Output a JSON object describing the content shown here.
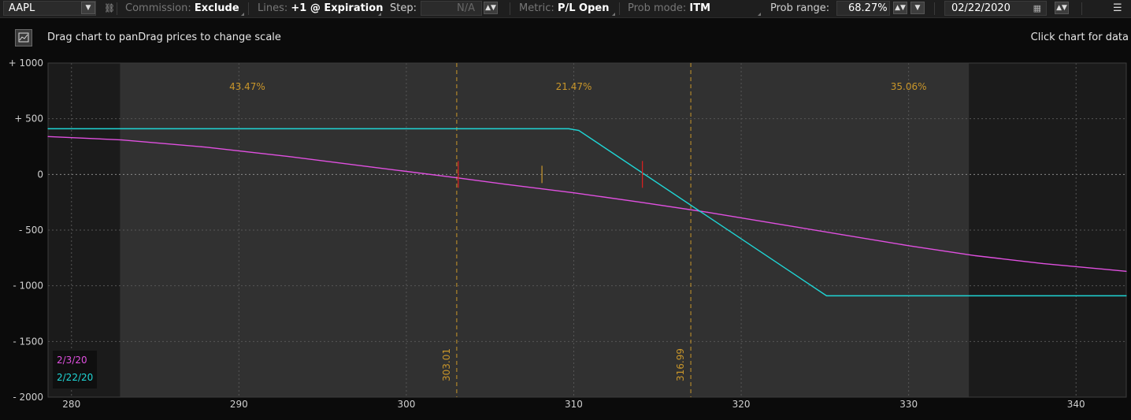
{
  "toolbar": {
    "symbol": "AAPL",
    "commission_label": "Commission:",
    "commission_value": "Exclude",
    "lines_label": "Lines:",
    "lines_value": "+1 @ Expiration",
    "step_label": "Step:",
    "step_value": "N/A",
    "metric_label": "Metric:",
    "metric_value": "P/L Open",
    "prob_mode_label": "Prob mode:",
    "prob_mode_value": "ITM",
    "prob_range_label": "Prob range:",
    "prob_range_value": "68.27%",
    "date_value": "02/22/2020"
  },
  "info": {
    "hint": "Drag chart to panDrag prices to change scale",
    "click_hint": "Click chart for data"
  },
  "colors": {
    "series_2_3_20": "#e050e0",
    "series_2_22_20": "#1fd6d6",
    "marker": "#e02020",
    "range_line": "#c9962a"
  },
  "chart_data": {
    "type": "line",
    "xlim": [
      278.6,
      343
    ],
    "ylim": [
      -2000,
      1000
    ],
    "x_ticks": [
      280,
      290,
      300,
      310,
      320,
      330,
      340
    ],
    "y_ticks": [
      1000,
      500,
      0,
      -500,
      -1000,
      -1500,
      -2000
    ],
    "y_tick_labels": [
      "+ 1000",
      "+ 500",
      "0",
      "- 500",
      "- 1000",
      "- 1500",
      "- 2000"
    ],
    "x_tick_labels": [
      "280",
      "290",
      "300",
      "310",
      "320",
      "330",
      "340"
    ],
    "prob_zones": [
      {
        "label": "43.47%",
        "x": 290.5
      },
      {
        "label": "21.47%",
        "x": 310
      },
      {
        "label": "35.06%",
        "x": 330
      }
    ],
    "range_lines": [
      {
        "x": 303.01,
        "label": "303.01"
      },
      {
        "x": 316.99,
        "label": "316.99"
      }
    ],
    "shaded_region": [
      282.9,
      333.6
    ],
    "series": [
      {
        "name": "2/3/20",
        "color": "#e050e0",
        "x": [
          278.6,
          283,
          288,
          293,
          298,
          303,
          306,
          310,
          314,
          318,
          322,
          326,
          330,
          334,
          338,
          343
        ],
        "y": [
          340,
          310,
          245,
          160,
          65,
          -30,
          -90,
          -165,
          -250,
          -340,
          -440,
          -540,
          -640,
          -730,
          -800,
          -870
        ]
      },
      {
        "name": "2/22/20",
        "color": "#1fd6d6",
        "x": [
          278.6,
          309.7,
          310.3,
          325.1,
          343
        ],
        "y": [
          410,
          410,
          395,
          -1090,
          -1090
        ]
      }
    ],
    "markers": [
      {
        "x": 303.1,
        "y": 0,
        "color": "#e02020"
      },
      {
        "x": 308.1,
        "y": 0,
        "color": "#c9962a"
      },
      {
        "x": 314.1,
        "y": 0,
        "color": "#e02020"
      }
    ],
    "legend": [
      "2/3/20",
      "2/22/20"
    ]
  }
}
